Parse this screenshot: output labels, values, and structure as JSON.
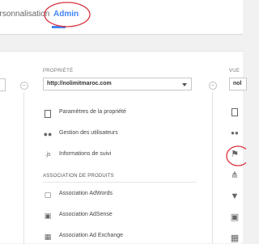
{
  "header": {
    "tabs": [
      {
        "label": "ersonnalisation",
        "active": false
      },
      {
        "label": "Admin",
        "active": true
      }
    ],
    "accent_color": "#4285f4",
    "annotation_color": "#d9333f"
  },
  "property_column": {
    "label": "PROPRIÉTÉ",
    "selected": "http://nolimitmaroc.com",
    "items": [
      {
        "label": "Paramètres de la propriété",
        "icon": "document-icon"
      },
      {
        "label": "Gestion des utilisateurs",
        "icon": "users-icon"
      },
      {
        "label": "Informations de suivi",
        "icon": "js-icon",
        "icon_text": ".js"
      }
    ],
    "product_section": {
      "label": "ASSOCIATION DE PRODUITS",
      "items": [
        {
          "label": "Association AdWords",
          "icon": "adwords-icon"
        },
        {
          "label": "Association AdSense",
          "icon": "adsense-icon"
        },
        {
          "label": "Association Ad Exchange",
          "icon": "adexchange-icon"
        }
      ]
    }
  },
  "view_column": {
    "label": "VUE",
    "selected": "nol"
  }
}
